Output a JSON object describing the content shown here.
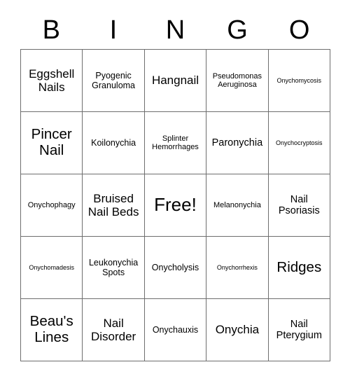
{
  "card": {
    "type": "bingo-card",
    "header_letters": [
      "B",
      "I",
      "N",
      "G",
      "O"
    ],
    "grid_size": "5x5",
    "border_color": "#6e6e6e",
    "background_color": "#ffffff",
    "text_color": "#000000",
    "free_space": {
      "row": 3,
      "column": 3,
      "label": "Free!"
    },
    "rows": [
      [
        {
          "label": "Eggshell Nails",
          "size": "xl"
        },
        {
          "label": "Pyogenic Granuloma",
          "size": "md"
        },
        {
          "label": "Hangnail",
          "size": "xl"
        },
        {
          "label": "Pseudomonas Aeruginosa",
          "size": "sm"
        },
        {
          "label": "Onychomycosis",
          "size": "xs"
        }
      ],
      [
        {
          "label": "Pincer Nail",
          "size": "xxl"
        },
        {
          "label": "Koilonychia",
          "size": "md"
        },
        {
          "label": "Splinter Hemorrhages",
          "size": "sm"
        },
        {
          "label": "Paronychia",
          "size": "lg"
        },
        {
          "label": "Onychocryptosis",
          "size": "xs"
        }
      ],
      [
        {
          "label": "Onychophagy",
          "size": "sm"
        },
        {
          "label": "Bruised Nail Beds",
          "size": "xl"
        },
        {
          "label": "Free!",
          "size": "free"
        },
        {
          "label": "Melanonychia",
          "size": "sm"
        },
        {
          "label": "Nail Psoriasis",
          "size": "lg"
        }
      ],
      [
        {
          "label": "Onychomadesis",
          "size": "xs"
        },
        {
          "label": "Leukonychia Spots",
          "size": "md"
        },
        {
          "label": "Onycholysis",
          "size": "md"
        },
        {
          "label": "Onychorrhexis",
          "size": "xs"
        },
        {
          "label": "Ridges",
          "size": "xxl"
        }
      ],
      [
        {
          "label": "Beau's Lines",
          "size": "xxl"
        },
        {
          "label": "Nail Disorder",
          "size": "xl"
        },
        {
          "label": "Onychauxis",
          "size": "md"
        },
        {
          "label": "Onychia",
          "size": "xl"
        },
        {
          "label": "Nail Pterygium",
          "size": "lg"
        }
      ]
    ]
  }
}
